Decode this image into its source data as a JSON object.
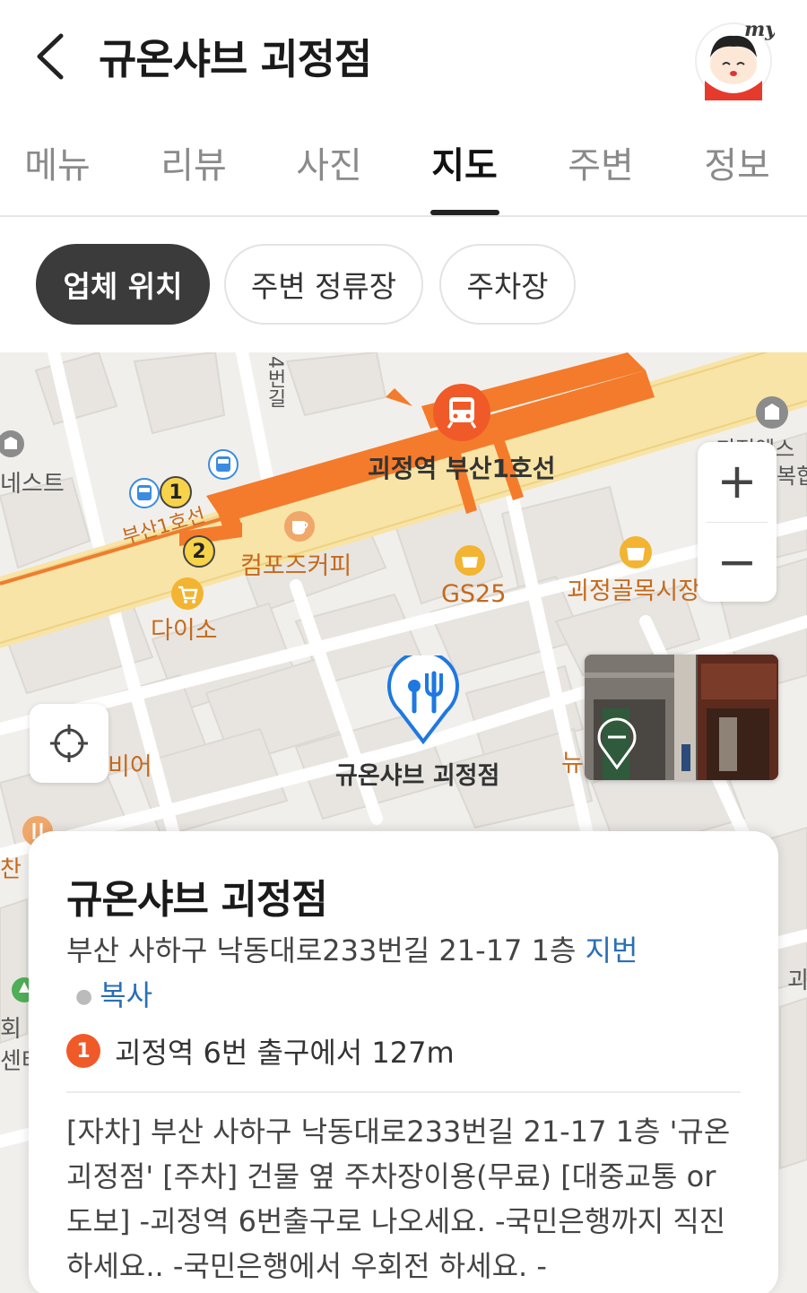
{
  "header": {
    "title": "규온샤브 괴정점",
    "avatar_alt": "my"
  },
  "tabs": [
    {
      "label": "메뉴",
      "active": false
    },
    {
      "label": "리뷰",
      "active": false
    },
    {
      "label": "사진",
      "active": false
    },
    {
      "label": "지도",
      "active": true
    },
    {
      "label": "주변",
      "active": false
    },
    {
      "label": "정보",
      "active": false
    }
  ],
  "chips": [
    {
      "label": "업체 위치",
      "active": true
    },
    {
      "label": "주변 정류장",
      "active": false
    },
    {
      "label": "주차장",
      "active": false
    }
  ],
  "map": {
    "labels": {
      "station": "괴정역 부산1호선",
      "line": "부산1호선",
      "cafe": "컴포즈커피",
      "gs25": "GS25",
      "market": "괴정골목시장",
      "daiso": "다이소",
      "store_name": "규온샤브 괴정점",
      "road": "4번길",
      "nest": "네스트",
      "officetel": "괴정엑스",
      "complex": "복합",
      "beer": "비어",
      "new": "뉴",
      "gwa": "괴",
      "hoe": "회",
      "center": "센터",
      "chan": "찬",
      "exit1": "1",
      "exit2": "2"
    },
    "zoom_in": "+",
    "zoom_out": "−",
    "icons": {
      "pin": "restaurant-pin-icon",
      "locate": "crosshair-icon",
      "roadview": "roadview-pin-icon"
    }
  },
  "card": {
    "title": "규온샤브 괴정점",
    "address": "부산 사하구 낙동대로233번길 21-17 1층",
    "address_link1": "지번",
    "address_link2": "복사",
    "subway_num": "1",
    "subway_text": "괴정역 6번 출구에서 127m",
    "description": "[자차] 부산 사하구 낙동대로233번길 21-17 1층 '규온 괴정점' [주차] 건물 옆 주차장이용(무료) [대중교통 or 도보] -괴정역 6번출구로 나오세요. -국민은행까지 직진하세요.. -국민은행에서 우회전 하세요. -"
  },
  "colors": {
    "accent_orange": "#f47d2e",
    "link_blue": "#2a6fb5",
    "pin_blue": "#1f78e0",
    "subway_badge": "#f05a28"
  }
}
